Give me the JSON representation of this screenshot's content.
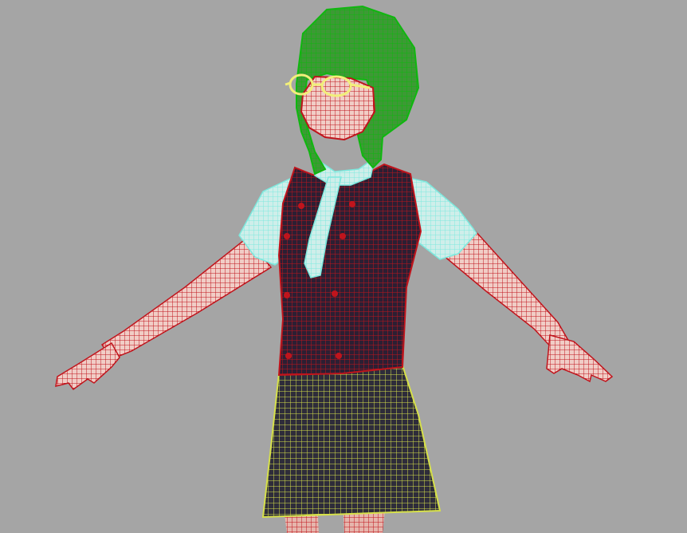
{
  "viewport": {
    "background": "#a5a5a5",
    "content": "wireframe-character-model"
  },
  "colors": {
    "body_mesh": "#c0141c",
    "vest_fill": "#2c1f33",
    "hair_mesh": "#0fb70f",
    "hair_fill": "#3d9a35",
    "shirt_mesh": "#7de9de",
    "shirt_fill": "#cfeeea",
    "skirt_mesh": "#d6e04a",
    "skirt_fill": "#2e2c3a",
    "glasses_mesh": "#f2ef7a"
  },
  "model_parts": [
    "hair",
    "head",
    "glasses",
    "collar",
    "tie",
    "sleeves",
    "vest",
    "arms",
    "hands",
    "skirt",
    "legs"
  ]
}
